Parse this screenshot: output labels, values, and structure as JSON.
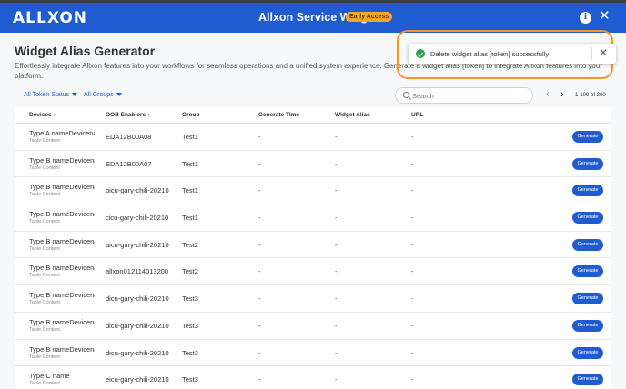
{
  "header": {
    "logo": "ALLXON",
    "title": "Allxon Service Widget",
    "badge": "Early Access",
    "info_icon": "info-icon",
    "close_icon": "close-icon"
  },
  "page": {
    "title": "Widget Alias Generator",
    "description": "Effortlessly integrate Allxon features into your workflows for seamless operations and a unified system experience. Generate a widget alias [token] to integrate Allxon features into your platform."
  },
  "filters": {
    "token_status": "All Token Status",
    "groups": "All Groups"
  },
  "search": {
    "placeholder": "Search"
  },
  "pager": {
    "text": "1-100 of 200"
  },
  "table": {
    "columns": {
      "devices": "Devices",
      "oob": "OOB Enablers",
      "group": "Group",
      "generate_time": "Generate Time",
      "widget_alias": "Widget Alias",
      "url": "URL"
    },
    "rows": [
      {
        "device": "Type A nameDevicename",
        "sub": "Table Content",
        "oob": "EDA12B00A08",
        "group": "Test1",
        "gen_time": "-",
        "alias": "-",
        "url": "-",
        "action": "Generate"
      },
      {
        "device": "Type B nameDevicename",
        "sub": "Table Content",
        "oob": "EDA12B00A07",
        "group": "Test1",
        "gen_time": "-",
        "alias": "-",
        "url": "-",
        "action": "Generate"
      },
      {
        "device": "Type B nameDevicename",
        "sub": "Table Content",
        "oob": "bicu-gary-chili-20210",
        "group": "Test1",
        "gen_time": "-",
        "alias": "-",
        "url": "-",
        "action": "Generate"
      },
      {
        "device": "Type B nameDevicename",
        "sub": "Table Content",
        "oob": "cicu-gary-chili-20210",
        "group": "Test1",
        "gen_time": "-",
        "alias": "-",
        "url": "-",
        "action": "Generate"
      },
      {
        "device": "Type B nameDevicename",
        "sub": "Table Content",
        "oob": "aicu-gary-chili-20210",
        "group": "Test2",
        "gen_time": "-",
        "alias": "-",
        "url": "-",
        "action": "Generate"
      },
      {
        "device": "Type B nameDevicename",
        "sub": "Table Content",
        "oob": "allxon012114013200",
        "group": "Test2",
        "gen_time": "-",
        "alias": "-",
        "url": "-",
        "action": "Generate"
      },
      {
        "device": "Type B nameDevicename",
        "sub": "Table Content",
        "oob": "dicu-gary-chili-20210",
        "group": "Test3",
        "gen_time": "-",
        "alias": "-",
        "url": "-",
        "action": "Generate"
      },
      {
        "device": "Type B nameDevicename",
        "sub": "Table Content",
        "oob": "dicu-gary-chili-20210",
        "group": "Test3",
        "gen_time": "-",
        "alias": "-",
        "url": "-",
        "action": "Generate"
      },
      {
        "device": "Type B nameDevicename",
        "sub": "Table Content",
        "oob": "dicu-gary-chili-20210",
        "group": "Test3",
        "gen_time": "-",
        "alias": "-",
        "url": "-",
        "action": "Generate"
      },
      {
        "device": "Type C name",
        "sub": "Table Content",
        "oob": "eicu-gary-chili-20210",
        "group": "Test3",
        "gen_time": "-",
        "alias": "-",
        "url": "-",
        "action": "Generate"
      }
    ]
  },
  "toast": {
    "message": "Delete widget alias [token] successfully",
    "icon": "check-circle-icon",
    "close_icon": "close-icon"
  },
  "colors": {
    "primary": "#1f5bd1",
    "badge": "#f5a623",
    "highlight": "#f39a1e",
    "success": "#2e9e4a"
  }
}
